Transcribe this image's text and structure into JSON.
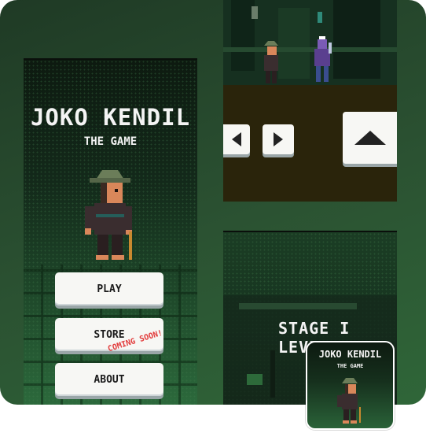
{
  "title_screen": {
    "title": "JOKO KENDIL",
    "subtitle": "THE GAME",
    "menu": {
      "play": "PLAY",
      "store": "STORE",
      "store_badge": "COMING SOON!",
      "about": "ABOUT"
    }
  },
  "gameplay": {
    "left_icon": "arrow-left-icon",
    "right_icon": "arrow-right-icon",
    "jump_icon": "arrow-up-icon"
  },
  "stage_screen": {
    "line1": "STAGE I",
    "line2": "LEVEL"
  },
  "app_icon": {
    "title": "JOKO KENDIL",
    "subtitle": "THE GAME"
  },
  "colors": {
    "card_bg": "#2b5232",
    "button_face": "#f7f7f4",
    "coming_soon": "#e23a3a",
    "ground": "#2a240b"
  }
}
